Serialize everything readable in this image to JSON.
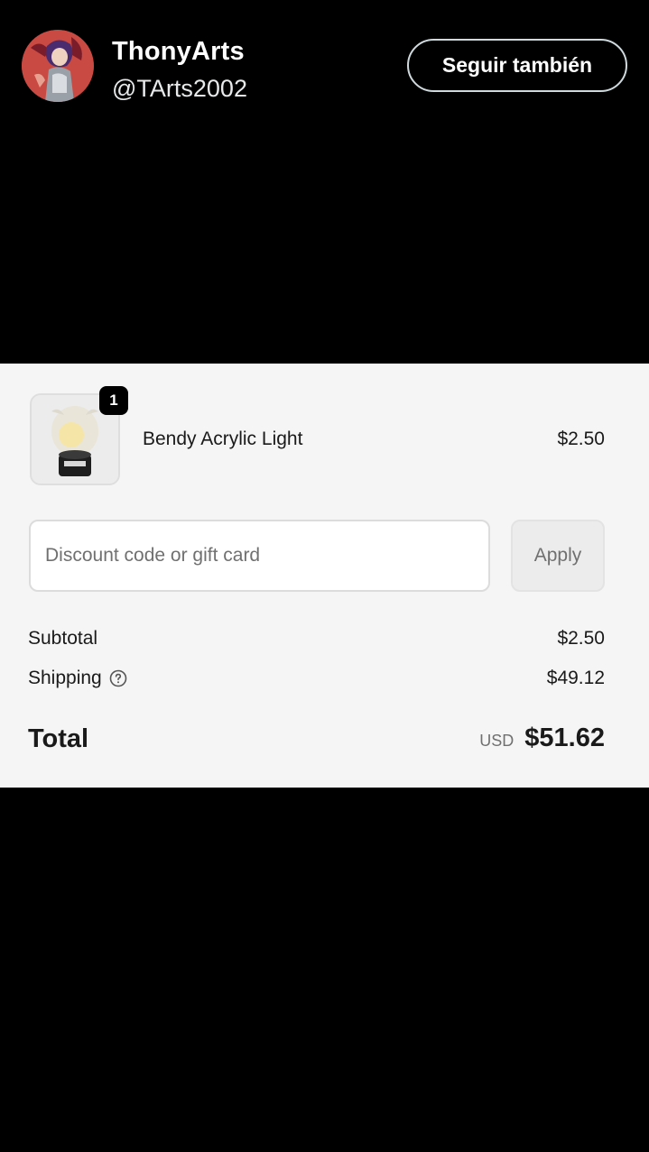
{
  "profile": {
    "name": "ThonyArts",
    "handle": "@TArts2002",
    "follow_label": "Seguir también"
  },
  "order": {
    "items": [
      {
        "name": "Bendy Acrylic Light",
        "price": "$2.50",
        "quantity": "1"
      }
    ],
    "discount": {
      "placeholder": "Discount code or gift card",
      "value": "",
      "apply_label": "Apply"
    },
    "subtotal_label": "Subtotal",
    "subtotal_value": "$2.50",
    "shipping_label": "Shipping",
    "shipping_value": "$49.12",
    "total_label": "Total",
    "total_currency": "USD",
    "total_value": "$51.62"
  },
  "icons": {
    "help": "question-circle-icon",
    "avatar": "profile-avatar",
    "product": "product-image"
  },
  "colors": {
    "page_background": "#000000",
    "panel_background": "#f5f5f5",
    "badge_background": "#000000"
  }
}
